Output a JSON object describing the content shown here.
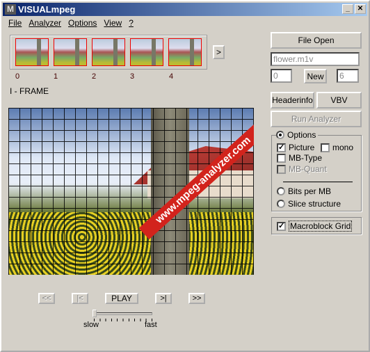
{
  "window": {
    "title": "VISUALmpeg",
    "logo": "M",
    "minimize": "_",
    "maximize": "□",
    "close": "✕"
  },
  "menu": [
    "File",
    "Analyzer",
    "Options",
    "View",
    "?"
  ],
  "thumbnails": {
    "labels": [
      "0",
      "1",
      "2",
      "3",
      "4"
    ],
    "next": ">"
  },
  "frame_type": "I - FRAME",
  "watermark": "www.mpeg-analyzer.com",
  "right": {
    "file_open": "File Open",
    "filename": "flower.m1v",
    "start": "0",
    "new": "New",
    "end": "6",
    "headerinfo": "Headerinfo",
    "vbv": "VBV",
    "run": "Run Analyzer"
  },
  "options": {
    "label": "Options",
    "selected": true,
    "picture": {
      "label": "Picture",
      "checked": true
    },
    "mono": {
      "label": "mono",
      "checked": false
    },
    "mbtype": {
      "label": "MB-Type",
      "checked": false
    },
    "mbquant": {
      "label": "MB-Quant",
      "checked": false,
      "disabled": true
    },
    "bits": {
      "label": "Bits per MB",
      "selected": false
    },
    "slice": {
      "label": "Slice structure",
      "selected": false
    }
  },
  "macroblock_grid": {
    "label": "Macroblock Grid",
    "checked": true
  },
  "playback": {
    "rewind": "<<",
    "prev": "|<",
    "play": "PLAY",
    "next": ">|",
    "forward": ">>",
    "slow": "slow",
    "fast": "fast",
    "speed": 0
  }
}
